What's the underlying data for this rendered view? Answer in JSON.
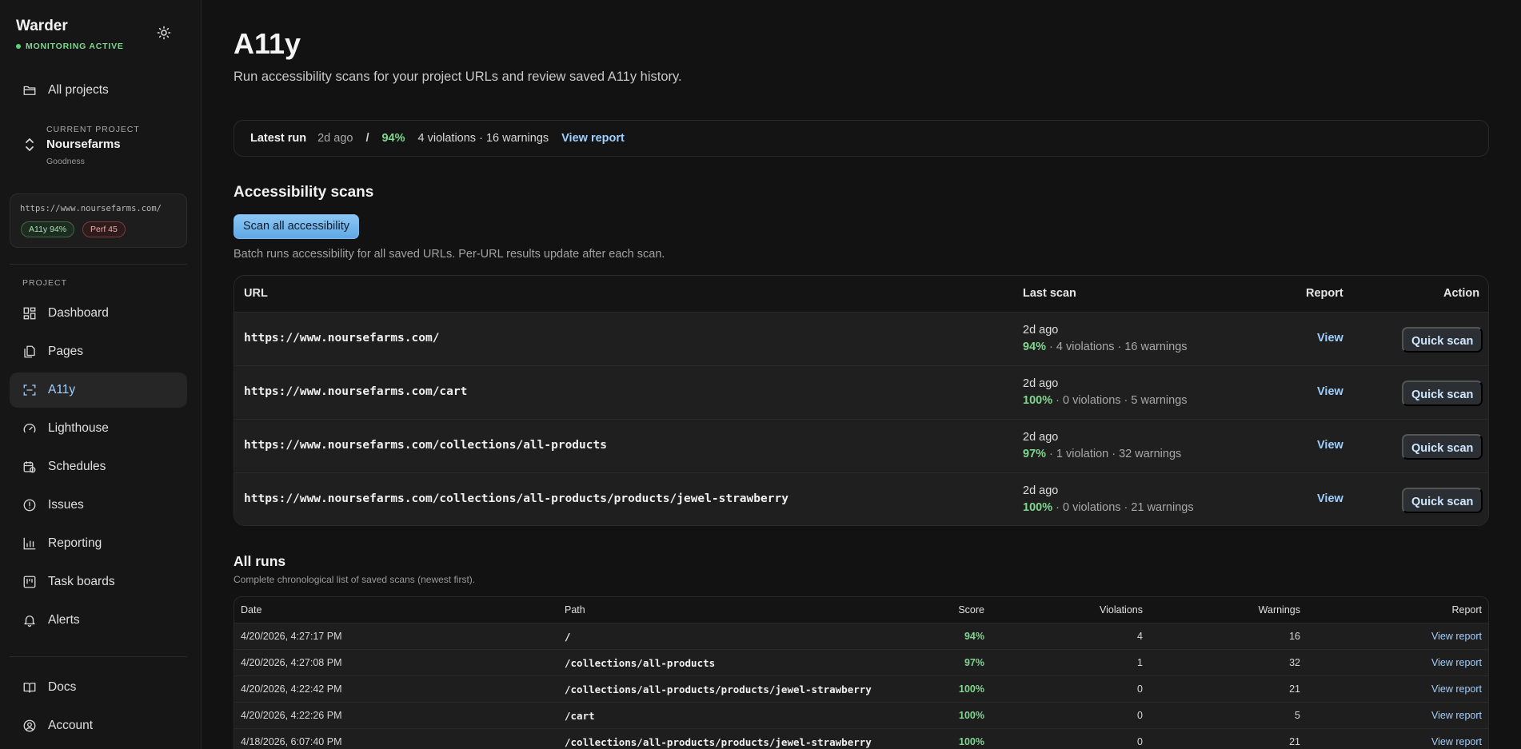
{
  "app": {
    "brand": "Warder",
    "status": "MONITORING ACTIVE",
    "theme_icon": "sun-icon"
  },
  "sidebar": {
    "all_projects": "All projects",
    "current_project": {
      "label": "CURRENT PROJECT",
      "name": "Noursefarms",
      "sub": "Goodness"
    },
    "url_card": {
      "url": "https://www.noursefarms.com/",
      "a11y_badge": "A11y 94%",
      "perf_badge": "Perf 45"
    },
    "section_label": "PROJECT",
    "items": [
      {
        "label": "Dashboard",
        "icon": "dashboard-icon"
      },
      {
        "label": "Pages",
        "icon": "pages-icon"
      },
      {
        "label": "A11y",
        "icon": "scan-icon",
        "active": true
      },
      {
        "label": "Lighthouse",
        "icon": "gauge-icon"
      },
      {
        "label": "Schedules",
        "icon": "calendar-icon"
      },
      {
        "label": "Issues",
        "icon": "alert-circle-icon"
      },
      {
        "label": "Reporting",
        "icon": "bar-chart-icon"
      },
      {
        "label": "Task boards",
        "icon": "kanban-icon"
      },
      {
        "label": "Alerts",
        "icon": "bell-icon"
      }
    ],
    "footer": [
      {
        "label": "Docs",
        "icon": "book-icon"
      },
      {
        "label": "Account",
        "icon": "user-circle-icon"
      }
    ]
  },
  "main": {
    "title": "A11y",
    "subtitle": "Run accessibility scans for your project URLs and review saved A11y history.",
    "latest": {
      "label": "Latest run",
      "time": "2d ago",
      "sep": "/",
      "score": "94%",
      "counts": "4 violations · 16 warnings",
      "link": "View report"
    },
    "scans": {
      "heading": "Accessibility scans",
      "button": "Scan all accessibility",
      "hint": "Batch runs accessibility for all saved URLs. Per-URL results update after each scan.",
      "columns": {
        "url": "URL",
        "last": "Last scan",
        "report": "Report",
        "action": "Action"
      },
      "rows": [
        {
          "url": "https://www.noursefarms.com/",
          "when": "2d ago",
          "score": "94%",
          "detail": " · 4 violations · 16 warnings",
          "view": "View",
          "action": "Quick scan"
        },
        {
          "url": "https://www.noursefarms.com/cart",
          "when": "2d ago",
          "score": "100%",
          "detail": " · 0 violations · 5 warnings",
          "view": "View",
          "action": "Quick scan"
        },
        {
          "url": "https://www.noursefarms.com/collections/all-products",
          "when": "2d ago",
          "score": "97%",
          "detail": " · 1 violation · 32 warnings",
          "view": "View",
          "action": "Quick scan"
        },
        {
          "url": "https://www.noursefarms.com/collections/all-products/products/jewel-strawberry",
          "when": "2d ago",
          "score": "100%",
          "detail": " · 0 violations · 21 warnings",
          "view": "View",
          "action": "Quick scan"
        }
      ]
    },
    "runs": {
      "heading": "All runs",
      "subtitle": "Complete chronological list of saved scans (newest first).",
      "columns": {
        "date": "Date",
        "path": "Path",
        "score": "Score",
        "violations": "Violations",
        "warnings": "Warnings",
        "report": "Report"
      },
      "rows": [
        {
          "date": "4/20/2026, 4:27:17 PM",
          "path": "/",
          "score": "94%",
          "violations": "4",
          "warnings": "16",
          "report": "View report"
        },
        {
          "date": "4/20/2026, 4:27:08 PM",
          "path": "/collections/all-products",
          "score": "97%",
          "violations": "1",
          "warnings": "32",
          "report": "View report"
        },
        {
          "date": "4/20/2026, 4:22:42 PM",
          "path": "/collections/all-products/products/jewel-strawberry",
          "score": "100%",
          "violations": "0",
          "warnings": "21",
          "report": "View report"
        },
        {
          "date": "4/20/2026, 4:22:26 PM",
          "path": "/cart",
          "score": "100%",
          "violations": "0",
          "warnings": "5",
          "report": "View report"
        },
        {
          "date": "4/18/2026, 6:07:40 PM",
          "path": "/collections/all-products/products/jewel-strawberry",
          "score": "100%",
          "violations": "0",
          "warnings": "21",
          "report": "View report"
        }
      ]
    }
  }
}
